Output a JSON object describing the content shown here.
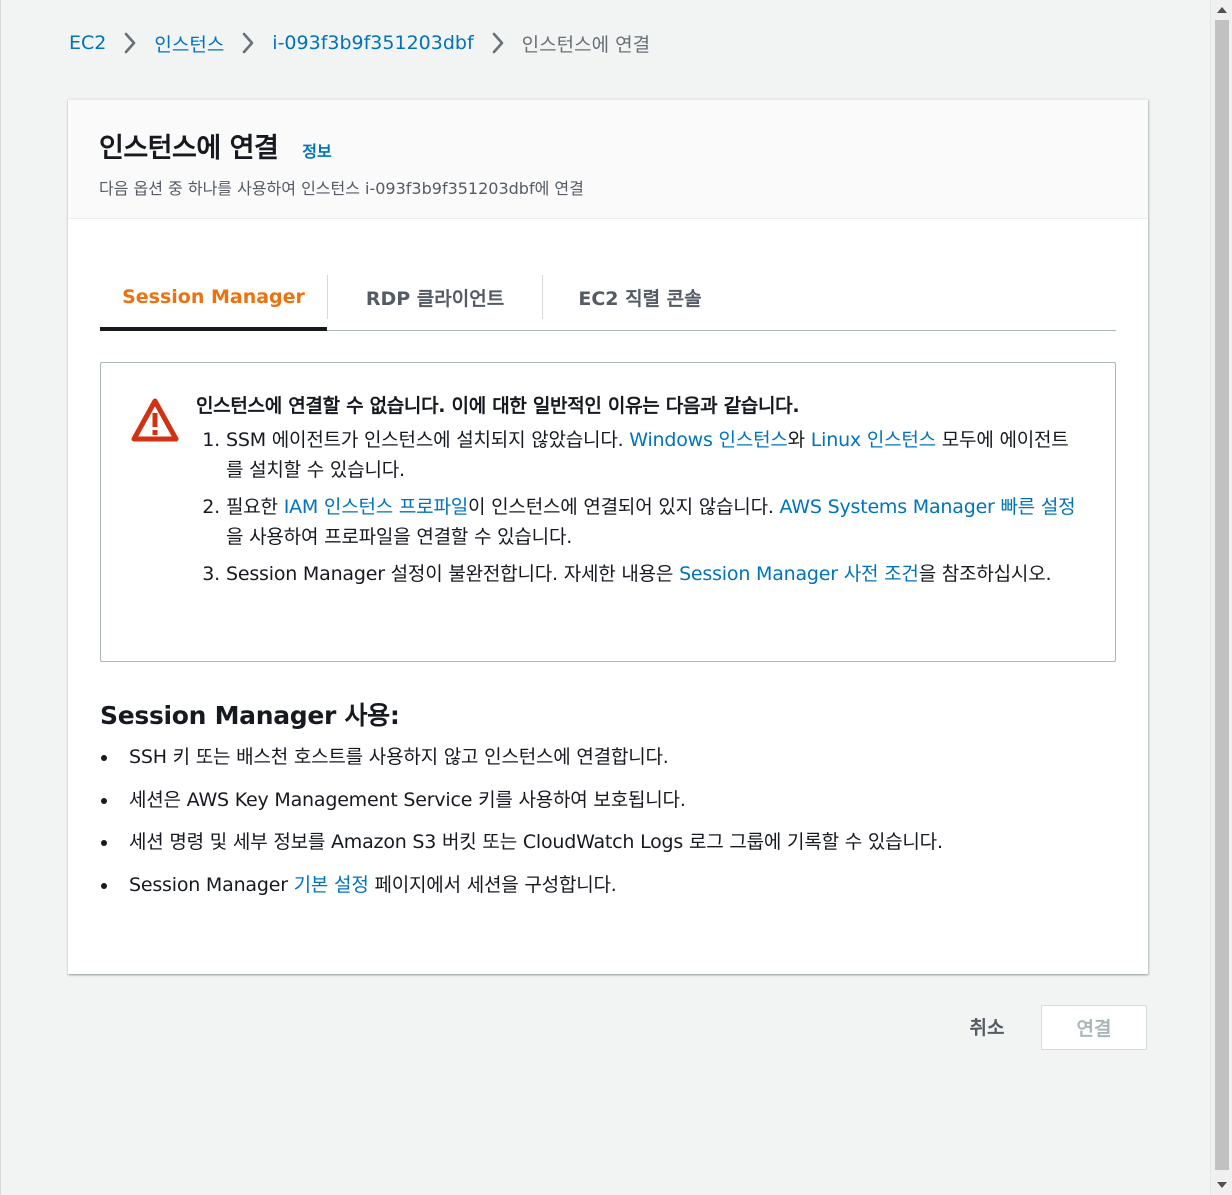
{
  "breadcrumb": {
    "items": [
      "EC2",
      "인스턴스",
      "i-093f3b9f351203dbf"
    ],
    "current": "인스턴스에 연결"
  },
  "header": {
    "title": "인스턴스에 연결",
    "info": "정보",
    "subtitle": "다음 옵션 중 하나를 사용하여 인스턴스 i-093f3b9f351203dbf에 연결"
  },
  "tabs": [
    {
      "label": "Session Manager",
      "active": true
    },
    {
      "label": "RDP 클라이언트",
      "active": false
    },
    {
      "label": "EC2 직렬 콘솔",
      "active": false
    }
  ],
  "alert": {
    "title": "인스턴스에 연결할 수 없습니다. 이에 대한 일반적인 이유는 다음과 같습니다.",
    "items": [
      {
        "num": "1.",
        "t1": "SSM 에이전트가 인스턴스에 설치되지 않았습니다. ",
        "link1": "Windows 인스턴스",
        "t2": "와 ",
        "link2": "Linux 인스턴스",
        "t3": " 모두에 에이전트를 설치할 수 있습니다."
      },
      {
        "num": "2.",
        "t1": "필요한 ",
        "link1": "IAM 인스턴스 프로파일",
        "t2": "이 인스턴스에 연결되어 있지 않습니다. ",
        "link2": "AWS Systems Manager 빠른 설정",
        "t3": "을 사용하여 프로파일을 연결할 수 있습니다."
      },
      {
        "num": "3.",
        "t1": "Session Manager 설정이 불완전합니다. 자세한 내용은 ",
        "link1": "Session Manager 사전 조건",
        "t2": "을 참조하십시오."
      }
    ]
  },
  "usage": {
    "title": "Session Manager 사용:",
    "items": [
      {
        "text": "SSH 키 또는 배스천 호스트를 사용하지 않고 인스턴스에 연결합니다."
      },
      {
        "text": "세션은 AWS Key Management Service 키를 사용하여 보호됩니다."
      },
      {
        "text": "세션 명령 및 세부 정보를 Amazon S3 버킷 또는 CloudWatch Logs 로그 그룹에 기록할 수 있습니다."
      },
      {
        "t1": "Session Manager ",
        "link": "기본 설정",
        "t2": " 페이지에서 세션을 구성합니다."
      }
    ]
  },
  "footer": {
    "cancel": "취소",
    "connect": "연결"
  },
  "colors": {
    "link": "#0073bb",
    "active_tab": "#ec7211",
    "warning": "#d13212"
  },
  "icons": [
    "chevron-right-icon",
    "warning-icon",
    "scroll-up-arrow-icon",
    "scroll-down-arrow-icon"
  ]
}
